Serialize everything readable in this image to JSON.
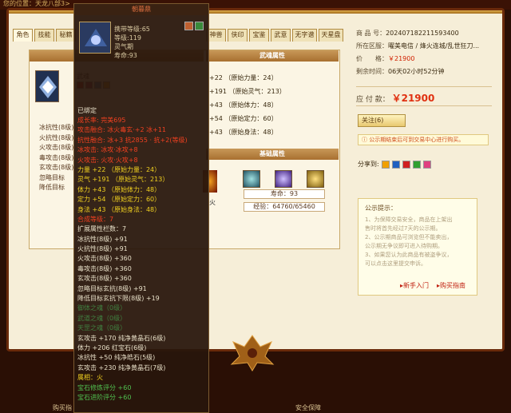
{
  "breadcrumb": "您的位置：天龙八部3>",
  "tabs_left": [
    "角色",
    "技能",
    "秘籍"
  ],
  "tabs_right": [
    "神兽",
    "侠印",
    "宝鉴",
    "武意",
    "无字谱",
    "天星盘"
  ],
  "panel": {
    "left_name": "武魂",
    "left_stats": [
      "冰抗性(8级)",
      "火抗性(8级)",
      "火攻击(8级)",
      "毒攻击(8级)",
      "玄攻击(8级)",
      "忽略目标",
      "降低目标"
    ],
    "right_header": "武魂属性",
    "right_stats": [
      "+22 （原始力量：24）",
      "+191 （原始灵气：213）",
      "+43 （原始体力：48）",
      "+54 （原始定力：60）",
      "+43 （原始身法：48）"
    ],
    "base_header": "基础属性",
    "fire_label": "火",
    "life_text": "寿命：93",
    "exp_text": "经验：64760/65460"
  },
  "goods": {
    "id_label": "商 品 号：",
    "id_value": "202407182211593400",
    "server_label": "所在区服：",
    "server_value": "曜美电信 / 烽火连城/乱世狂刀...",
    "price_label": "价　　格：",
    "price_value": "￥21900",
    "time_label": "剩余时间：",
    "time_value": "06天02小时52分钟",
    "pay_label": "应 付 款：",
    "pay_value": "￥21900",
    "follow": "关注(6)",
    "notice": "公示期结束后可到交易中心进行购买。",
    "share": "分享到:"
  },
  "notebox": {
    "title": "公示提示：",
    "lines": [
      "1、为保障交易安全，商品在上架出",
      "售时将首先经过7天的公示期。",
      "2、公示期商品可浏览但不能卖出，",
      "公示期无争议即可进入待购期。",
      "3、如果您认为此商品有被盗争议，",
      "可以点击这里提交申诉。"
    ],
    "link1": "新手入门",
    "link2": "购买指南"
  },
  "footer": {
    "left": "购买指",
    "right": "安全保障"
  },
  "tooltip": {
    "title": "朝暮鼎",
    "top_lines": [
      "携带等级:65",
      "等级:119",
      "灵气期",
      "寿命:93"
    ],
    "bound": "已绑定",
    "lines": [
      {
        "t": "成长率: 完美695",
        "c": "r"
      },
      {
        "t": "攻击融合: 冰火毒玄·+2 冰+11",
        "c": "r"
      },
      {
        "t": "抗性融合: 冰+3 抗2855 · 抗+2(等级)",
        "c": "r"
      },
      {
        "t": "冰攻击: 冰攻·冰攻+8",
        "c": "r"
      },
      {
        "t": "火攻击: 火攻·火攻+8",
        "c": "r"
      },
      {
        "t": "力量 +22 （原始力量：24）",
        "c": "y"
      },
      {
        "t": "灵气 +191 （原始灵气：213）",
        "c": "y"
      },
      {
        "t": "体力 +43 （原始体力：48）",
        "c": "y"
      },
      {
        "t": "定力 +54 （原始定力：60）",
        "c": "y"
      },
      {
        "t": "身法 +43 （原始身法：48）",
        "c": "y"
      },
      {
        "t": "合成等级：7",
        "c": "r"
      },
      {
        "t": "扩展属性栏数：7",
        "c": "w"
      },
      {
        "t": "冰抗性(8级) +91",
        "c": "w"
      },
      {
        "t": "火抗性(8级) +91",
        "c": "w"
      },
      {
        "t": "火攻击(8级) +360",
        "c": "w"
      },
      {
        "t": "毒攻击(8级) +360",
        "c": "w"
      },
      {
        "t": "玄攻击(8级) +360",
        "c": "w"
      },
      {
        "t": "忽略目标玄抗(8级) +91",
        "c": "w"
      },
      {
        "t": "降低目标玄抗下限(8级) +19",
        "c": "w"
      },
      {
        "t": "御体之魂（0级）",
        "c": "dg"
      },
      {
        "t": "武道之魂（0级）",
        "c": "dg"
      },
      {
        "t": "天罡之魂（0级）",
        "c": "dg"
      },
      {
        "t": "玄攻击 +170 纯净黄晶石(6级)",
        "c": "w"
      },
      {
        "t": "体力 +206 红宝石(6级)",
        "c": "w"
      },
      {
        "t": "冰抗性 +50 纯净皓石(5级)",
        "c": "w"
      },
      {
        "t": "玄攻击 +230 纯净黄晶石(7级)",
        "c": "w"
      },
      {
        "t": "属相：火",
        "c": "y"
      },
      {
        "t": "宝石修炼评分 +60",
        "c": "g"
      },
      {
        "t": "宝石进阶评分 +60",
        "c": "g"
      }
    ]
  }
}
